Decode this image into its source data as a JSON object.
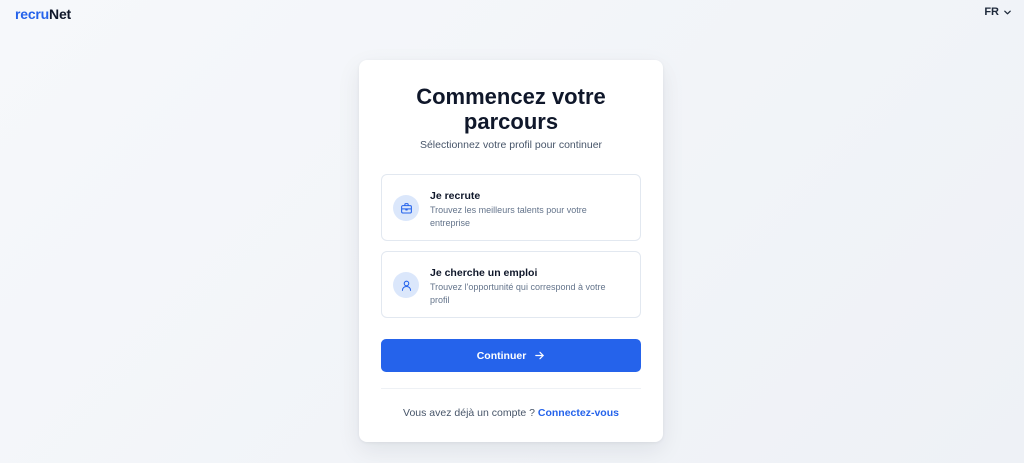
{
  "header": {
    "logo_part1": "recru",
    "logo_part2": "Net",
    "language": "FR",
    "language_icon": "chevron-down-icon"
  },
  "card": {
    "title": "Commencez votre parcours",
    "subtitle": "Sélectionnez votre profil pour continuer",
    "options": [
      {
        "icon": "briefcase-icon",
        "title": "Je recrute",
        "description": "Trouvez les meilleurs talents pour votre entreprise"
      },
      {
        "icon": "user-icon",
        "title": "Je cherche un emploi",
        "description": "Trouvez l'opportunité qui correspond à votre profil"
      }
    ],
    "continue_label": "Continuer",
    "continue_icon": "arrow-right-icon",
    "footer_text": "Vous avez déjà un compte ?",
    "footer_link": "Connectez-vous"
  },
  "colors": {
    "accent": "#2563eb",
    "icon_bg": "#dbe7fb",
    "text_dark": "#0f172a",
    "text_muted": "#64748b"
  }
}
